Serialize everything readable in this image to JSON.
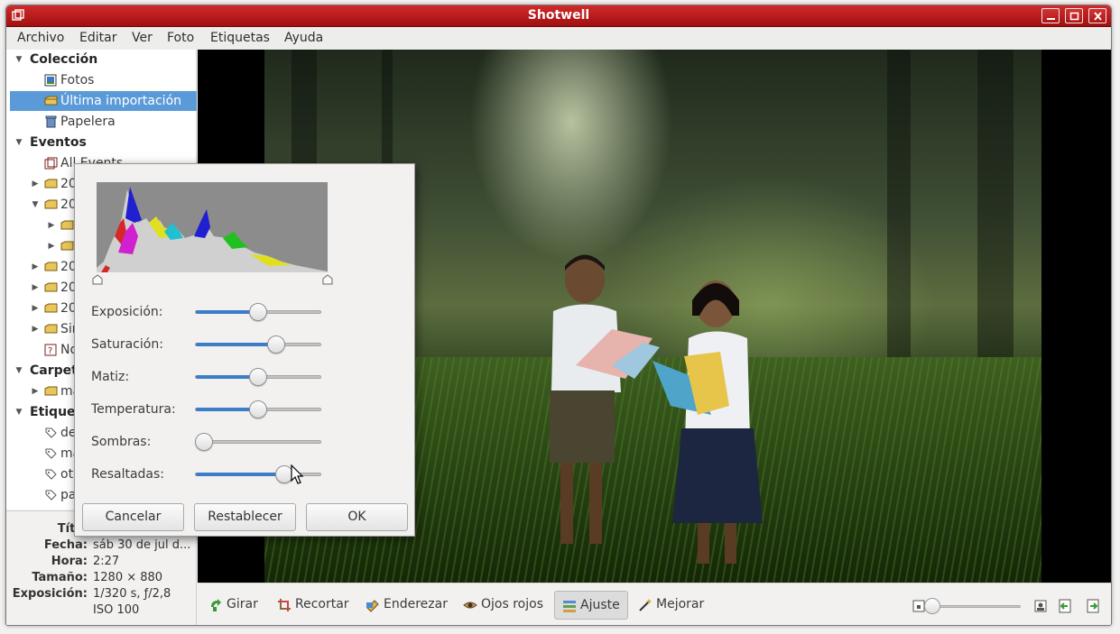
{
  "window": {
    "title": "Shotwell"
  },
  "menu": [
    "Archivo",
    "Editar",
    "Ver",
    "Foto",
    "Etiquetas",
    "Ayuda"
  ],
  "sidebar": {
    "rows": [
      {
        "label": "Colección",
        "type": "header",
        "icon": "expander-open"
      },
      {
        "label": "Fotos",
        "icon": "photos-icon"
      },
      {
        "label": "Última importación",
        "icon": "folder-icon",
        "selected": true
      },
      {
        "label": "Papelera",
        "icon": "trash-icon"
      },
      {
        "label": "Eventos",
        "type": "header",
        "icon": "expander-open"
      },
      {
        "label": "All Events",
        "icon": "events-icon"
      },
      {
        "label": "20",
        "icon": "folder-icon"
      },
      {
        "label": "20",
        "icon": "folder-icon"
      },
      {
        "label": "",
        "icon": "folder-icon"
      },
      {
        "label": "",
        "icon": "folder-icon"
      },
      {
        "label": "20",
        "icon": "folder-icon"
      },
      {
        "label": "20",
        "icon": "folder-icon"
      },
      {
        "label": "20",
        "icon": "folder-icon"
      },
      {
        "label": "Sin",
        "icon": "folder-icon"
      },
      {
        "label": "No",
        "icon": "no-event-icon"
      },
      {
        "label": "Carpet",
        "type": "header",
        "icon": "expander-open"
      },
      {
        "label": "ma",
        "icon": "folder-icon"
      },
      {
        "label": "Etique",
        "type": "header",
        "icon": "expander-open"
      },
      {
        "label": "de",
        "icon": "tag-icon"
      },
      {
        "label": "ma",
        "icon": "tag-icon"
      },
      {
        "label": "ot",
        "icon": "tag-icon"
      },
      {
        "label": "pa",
        "icon": "tag-icon"
      }
    ]
  },
  "info": {
    "titulo_label": "Títul",
    "fecha_label": "Fecha:",
    "fecha_value": "sáb 30 de jul d...",
    "hora_label": "Hora:",
    "hora_value": "2:27",
    "tamano_label": "Tamaño:",
    "tamano_value": "1280 × 880",
    "exposicion_label": "Exposición:",
    "exposicion_value": "1/320 s, ƒ/2,8",
    "iso_value": "ISO 100"
  },
  "dialog": {
    "sliders": [
      {
        "label": "Exposición:",
        "value": 0.5
      },
      {
        "label": "Saturación:",
        "value": 0.67
      },
      {
        "label": "Matiz:",
        "value": 0.5
      },
      {
        "label": "Temperatura:",
        "value": 0.5
      },
      {
        "label": "Sombras:",
        "value": 0.0
      },
      {
        "label": "Resaltadas:",
        "value": 0.74
      }
    ],
    "buttons": {
      "cancel": "Cancelar",
      "reset": "Restablecer",
      "ok": "OK"
    }
  },
  "toolbar": {
    "tools": [
      {
        "label": "Girar",
        "icon": "rotate-icon"
      },
      {
        "label": "Recortar",
        "icon": "crop-icon"
      },
      {
        "label": "Enderezar",
        "icon": "straighten-icon"
      },
      {
        "label": "Ojos rojos",
        "icon": "red-eye-icon"
      },
      {
        "label": "Ajuste",
        "icon": "adjust-icon",
        "active": true
      },
      {
        "label": "Mejorar",
        "icon": "enhance-icon"
      }
    ],
    "zoom_level": 0.0
  },
  "colors": {
    "titlebar": "#b71c1c",
    "selection": "#5b9ad9",
    "slider_fill": "#3c7dc8"
  }
}
